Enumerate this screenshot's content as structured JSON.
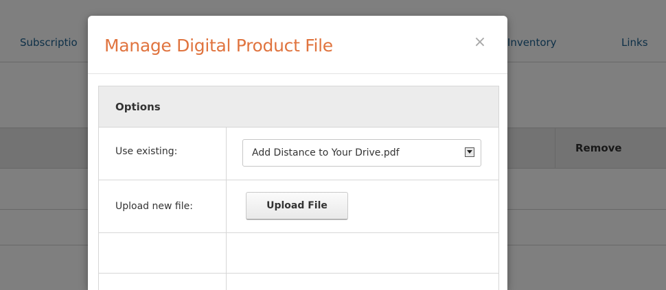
{
  "background": {
    "nav_tabs": [
      "Subscriptio",
      "ct Inventory",
      "Links"
    ],
    "table": {
      "remove_header": "Remove"
    }
  },
  "modal": {
    "title": "Manage Digital Product File",
    "close_label": "×",
    "options": {
      "header": "Options",
      "use_existing_label": "Use existing:",
      "use_existing_value": "Add Distance to Your Drive.pdf",
      "upload_label": "Upload new file:",
      "upload_button": "Upload File"
    }
  },
  "colors": {
    "title": "#e0743f",
    "link": "#1a5f8f",
    "overlay": "rgba(0,0,0,0.5)"
  }
}
